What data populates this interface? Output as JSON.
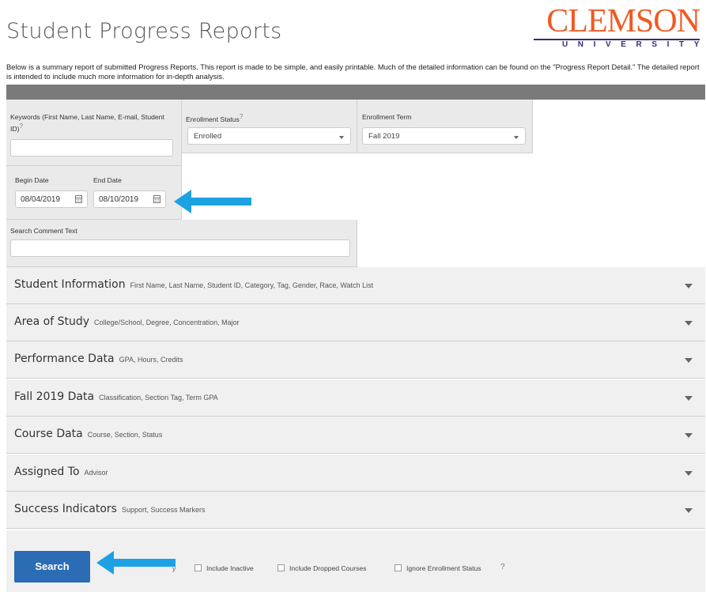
{
  "header": {
    "title": "Student Progress Reports",
    "logo_word": "CLEMSON",
    "logo_sub": "UNIVERSITY",
    "intro": "Below is a summary report of submitted Progress Reports. This report is made to be simple, and easily printable. Much of the detailed information can be found on the \"Progress Report Detail.\" The detailed report is intended to include much more information for in-depth analysis."
  },
  "filters": {
    "keywords_label": "Keywords (First Name, Last Name, E-mail, Student ID)",
    "keywords_help": "?",
    "keywords_value": "",
    "enrollment_status_label": "Enrollment Status",
    "enrollment_status_help": "?",
    "enrollment_status_value": "Enrolled",
    "enrollment_term_label": "Enrollment Term",
    "enrollment_term_value": "Fall 2019",
    "begin_date_label": "Begin Date",
    "begin_date_value": "08/04/2019",
    "end_date_label": "End Date",
    "end_date_value": "08/10/2019",
    "comment_label": "Search Comment Text",
    "comment_value": ""
  },
  "sections": [
    {
      "title": "Student Information",
      "subtitle": "First Name, Last Name, Student ID, Category, Tag, Gender, Race, Watch List"
    },
    {
      "title": "Area of Study",
      "subtitle": "College/School, Degree, Concentration, Major"
    },
    {
      "title": "Performance Data",
      "subtitle": "GPA, Hours, Credits"
    },
    {
      "title": "Fall 2019 Data",
      "subtitle": "Classification, Section Tag, Term GPA"
    },
    {
      "title": "Course Data",
      "subtitle": "Course, Section, Status"
    },
    {
      "title": "Assigned To",
      "subtitle": "Advisor"
    },
    {
      "title": "Success Indicators",
      "subtitle": "Support, Success Markers"
    }
  ],
  "footer": {
    "search_label": "Search",
    "partial_label": "y",
    "include_inactive": "Include Inactive",
    "include_dropped": "Include Dropped Courses",
    "ignore_enrollment": "Ignore Enrollment Status",
    "help": "?"
  },
  "colors": {
    "brand_orange": "#f05a22",
    "brand_purple": "#3a2a7a",
    "button_blue": "#2b6cb4",
    "arrow_blue": "#1da1e3"
  },
  "icons": [
    "calendar-icon",
    "chevron-down-icon",
    "arrow-left-icon",
    "help-icon"
  ]
}
